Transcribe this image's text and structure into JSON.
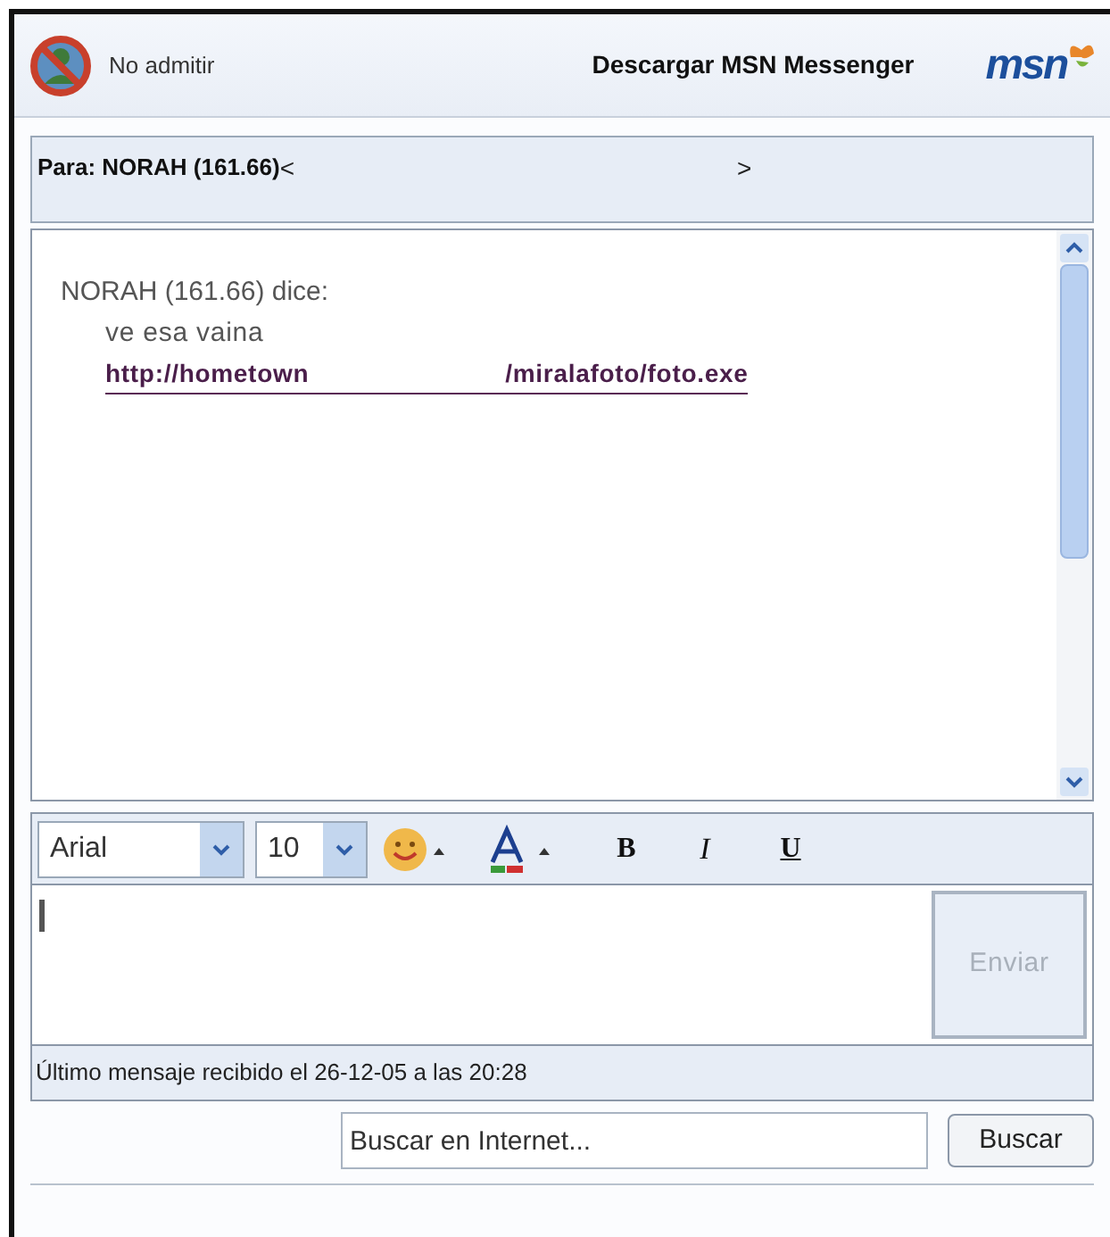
{
  "header": {
    "block_label": "No admitir",
    "download_link": "Descargar MSN Messenger",
    "logo": "msn"
  },
  "to_line": {
    "label": "Para: NORAH (161.66)",
    "open": "<",
    "close": ">"
  },
  "conversation": {
    "sender_line": "NORAH (161.66) dice:",
    "message": "ve esa vaina",
    "link_start": "http://hometown",
    "link_end": "/miralafoto/foto.exe"
  },
  "toolbar": {
    "font": "Arial",
    "size": "10",
    "bold": "B",
    "italic": "I",
    "underline": "U"
  },
  "compose": {
    "send_button": {
      "label": "Enviar",
      "disabled": true
    }
  },
  "status_bar": "Último mensaje recibido el 26-12-05 a las 20:28",
  "search": {
    "placeholder": "Buscar en Internet...",
    "button": "Buscar"
  }
}
